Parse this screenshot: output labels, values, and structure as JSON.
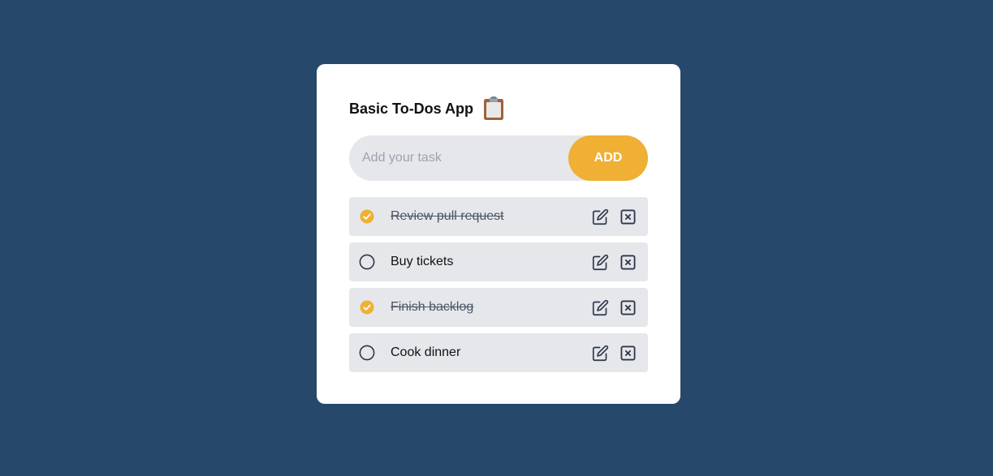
{
  "app": {
    "title": "Basic To-Dos App",
    "title_icon": "clipboard-icon"
  },
  "input": {
    "placeholder": "Add your task",
    "value": "",
    "add_label": "ADD"
  },
  "tasks": [
    {
      "text": "Review pull request",
      "done": true
    },
    {
      "text": "Buy tickets",
      "done": false
    },
    {
      "text": "Finish backlog",
      "done": true
    },
    {
      "text": "Cook dinner",
      "done": false
    }
  ],
  "icons": {
    "checked": "check-circle-icon",
    "unchecked": "circle-icon",
    "edit": "edit-icon",
    "delete": "close-box-icon"
  },
  "colors": {
    "background": "#25486b",
    "card": "#ffffff",
    "accent": "#efb033",
    "item_bg": "#e5e7eb",
    "icon": "#2d3748"
  }
}
